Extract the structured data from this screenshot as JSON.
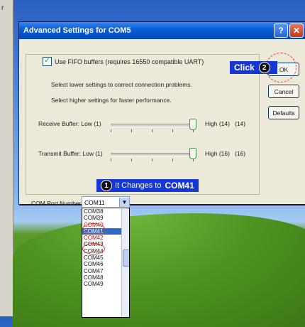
{
  "window": {
    "title": "Advanced Settings for COM5",
    "help": "?",
    "close": "✕"
  },
  "fifo": {
    "label": "Use FIFO buffers (requires 16550 compatible UART)",
    "checked": true
  },
  "hints": [
    "Select lower settings to correct connection problems.",
    "Select higher settings for faster performance."
  ],
  "receive": {
    "label": "Receive Buffer:",
    "low": "Low (1)",
    "high": "High (14)",
    "value": "(14)"
  },
  "transmit": {
    "label": "Transmit Buffer:",
    "low": "Low (1)",
    "high": "High (16)",
    "value": "(16)"
  },
  "buttons": {
    "ok": "OK",
    "cancel": "Cancel",
    "defaults": "Defaults"
  },
  "callouts": {
    "click_num": "2",
    "click_text": "Click",
    "change_num": "1",
    "change_text": "It Changes to",
    "change_target": "COM41"
  },
  "port": {
    "label": "COM Port Number:",
    "value": "COM11"
  },
  "options": [
    "COM38",
    "COM39",
    "COM40",
    "COM41",
    "COM42",
    "COM43",
    "COM44",
    "COM45",
    "COM46",
    "COM47",
    "COM48",
    "COM49"
  ],
  "selected_option": "COM41",
  "left_mark": "r"
}
